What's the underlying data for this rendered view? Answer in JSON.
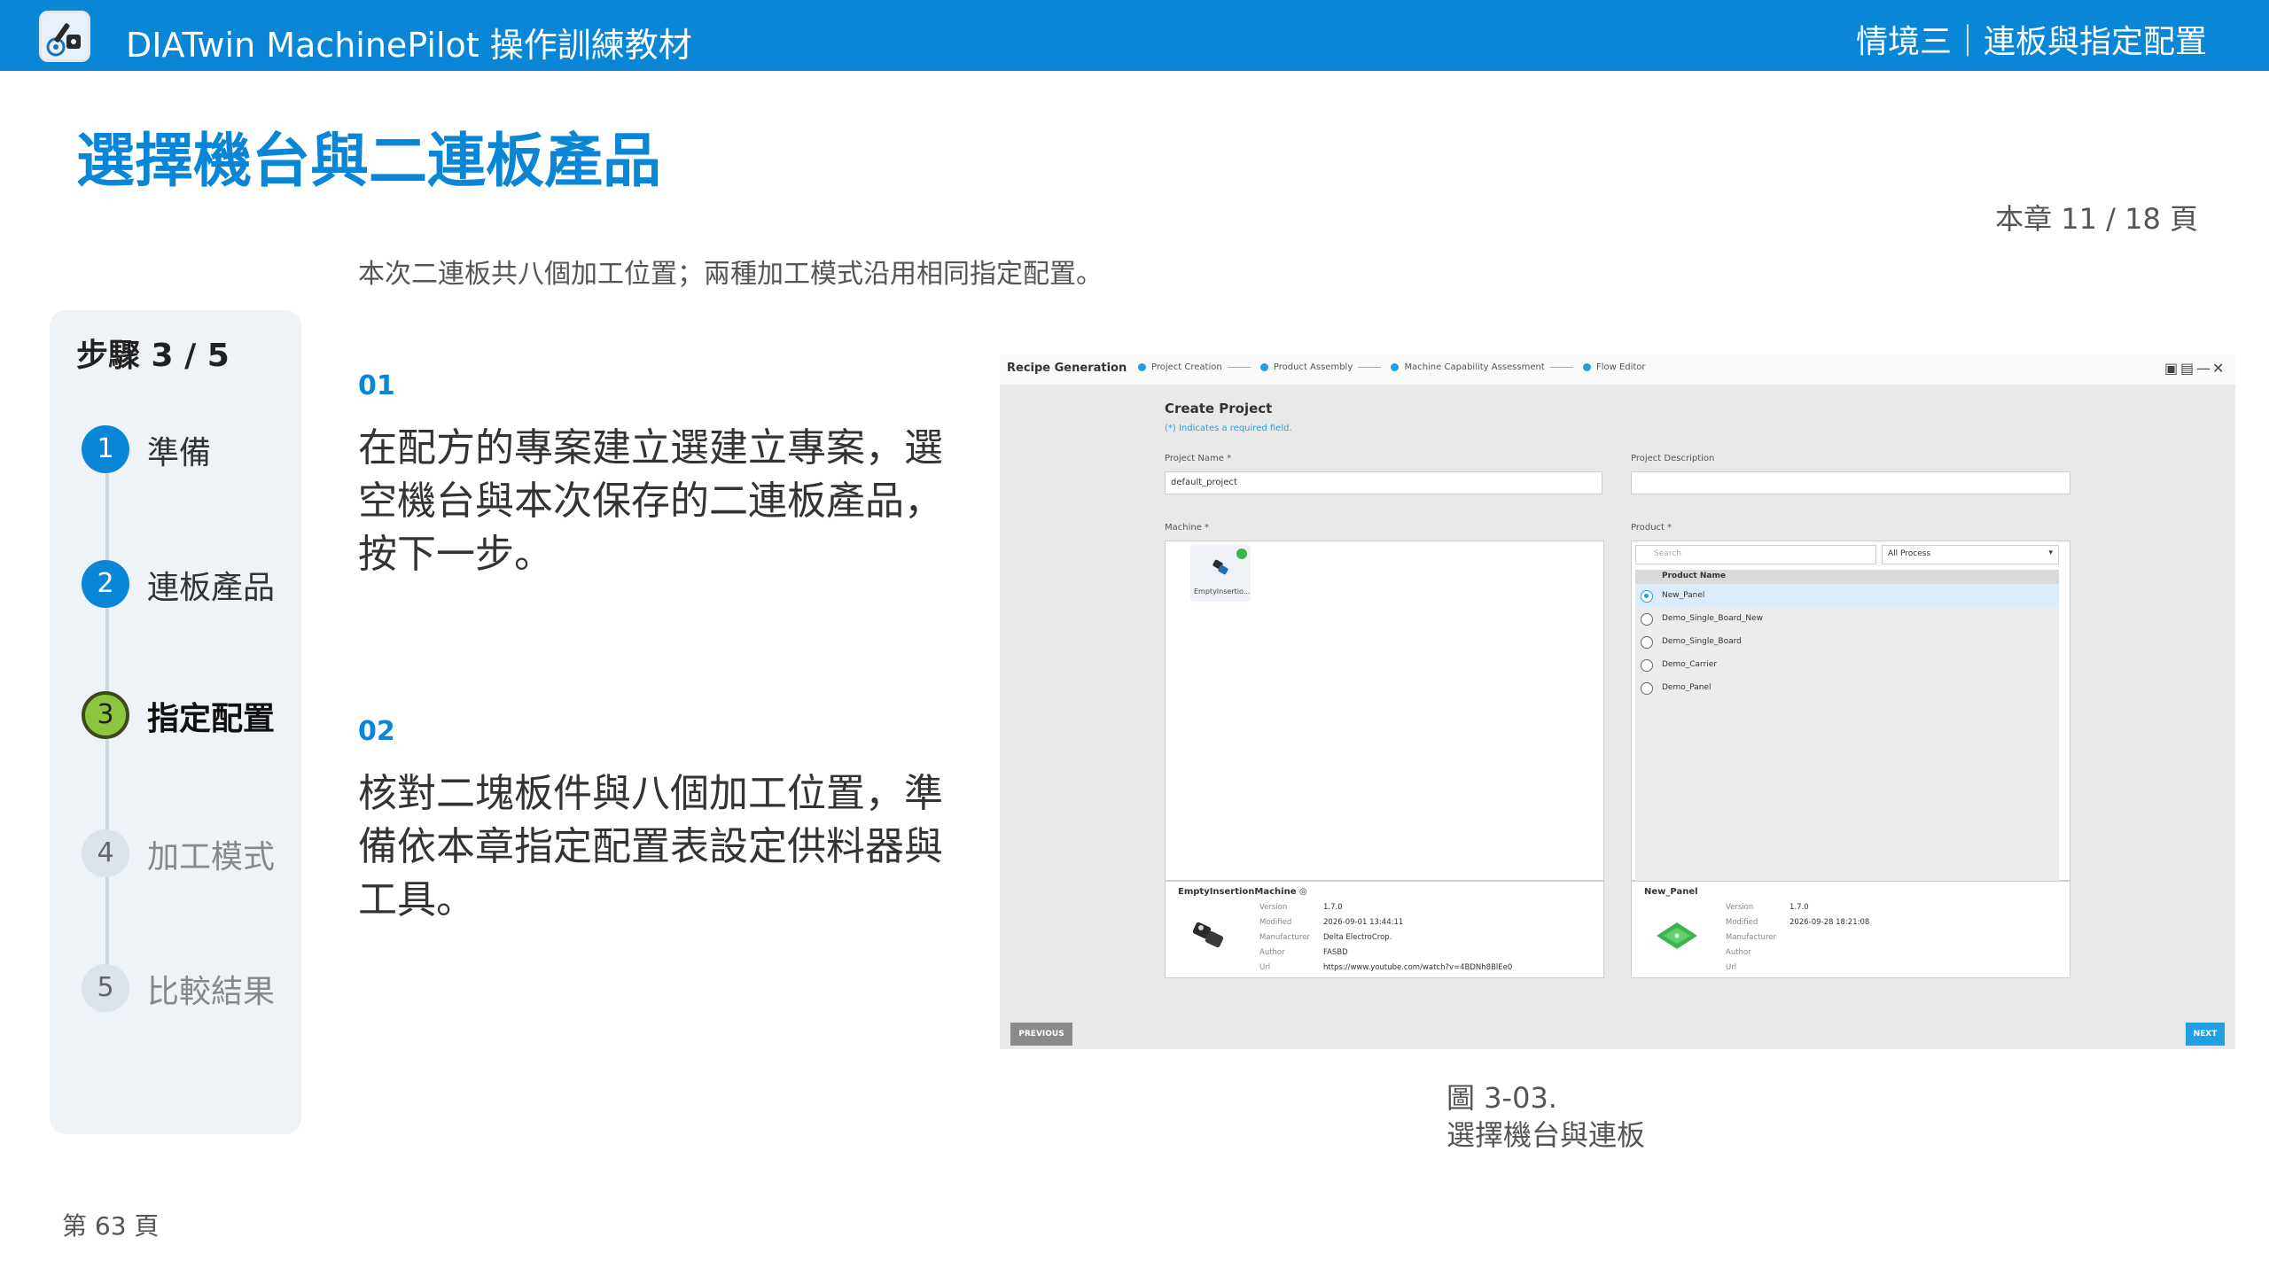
{
  "header": {
    "app_title": "DIATwin MachinePilot 操作訓練教材",
    "chapter_title": "情境三｜連板與指定配置"
  },
  "page": {
    "heading": "選擇機台與二連板產品",
    "chapter_page": "本章 11 / 18 頁",
    "intro": "本次二連板共八個加工位置；兩種加工模式沿用相同指定配置。",
    "page_number": "第 63 頁"
  },
  "steps": {
    "title": "步驟 3 / 5",
    "items": [
      {
        "num": "1",
        "label": "準備",
        "state": "done"
      },
      {
        "num": "2",
        "label": "連板產品",
        "state": "done"
      },
      {
        "num": "3",
        "label": "指定配置",
        "state": "current"
      },
      {
        "num": "4",
        "label": "加工模式",
        "state": "todo"
      },
      {
        "num": "5",
        "label": "比較結果",
        "state": "todo"
      }
    ]
  },
  "instructions": [
    {
      "num": "01",
      "text": "在配方的專案建立選建立專案，選空機台與本次保存的二連板產品，按下一步。"
    },
    {
      "num": "02",
      "text": "核對二塊板件與八個加工位置，準備依本章指定配置表設定供料器與工具。"
    }
  ],
  "screenshot": {
    "app_name": "Recipe Generation",
    "breadcrumbs": [
      "Project Creation",
      "Product Assembly",
      "Machine Capability Assessment",
      "Flow Editor"
    ],
    "window_icons": [
      "save-icon",
      "save-as-icon",
      "minimize-icon",
      "close-icon"
    ],
    "window_glyphs": [
      "▣",
      "▤",
      "—",
      "✕"
    ],
    "form_title": "Create Project",
    "required_note": "(*) Indicates a required field.",
    "project_name_label": "Project Name *",
    "project_name_value": "default_project",
    "project_desc_label": "Project Description",
    "project_desc_value": "",
    "machine_label": "Machine *",
    "machine_card_name": "EmptyInsertio...",
    "product_label": "Product *",
    "search_placeholder": "Search",
    "process_filter": "All Process",
    "product_header": "Product Name",
    "products": [
      {
        "name": "New_Panel",
        "selected": true
      },
      {
        "name": "Demo_Single_Board_New",
        "selected": false
      },
      {
        "name": "Demo_Single_Board",
        "selected": false
      },
      {
        "name": "Demo_Carrier",
        "selected": false
      },
      {
        "name": "Demo_Panel",
        "selected": false
      }
    ],
    "machine_info": {
      "name": "EmptyInsertionMachine",
      "fields": [
        {
          "key": "Version",
          "value": "1.7.0"
        },
        {
          "key": "Modified",
          "value": "2026-09-01 13:44:11"
        },
        {
          "key": "Manufacturer",
          "value": "Delta ElectroCrop."
        },
        {
          "key": "Author",
          "value": "FASBD"
        },
        {
          "key": "Url",
          "value": "https://www.youtube.com/watch?v=4BDNh8BlEe0"
        }
      ]
    },
    "product_info": {
      "name": "New_Panel",
      "fields": [
        {
          "key": "Version",
          "value": "1.7.0"
        },
        {
          "key": "Modified",
          "value": "2026-09-28 18:21:08"
        },
        {
          "key": "Manufacturer",
          "value": ""
        },
        {
          "key": "Author",
          "value": ""
        },
        {
          "key": "Url",
          "value": ""
        }
      ]
    },
    "previous_label": "PREVIOUS",
    "next_label": "NEXT",
    "colors": {
      "accent": "#1ea0e3",
      "pcb": "#3fb34f"
    }
  },
  "caption": {
    "line1": "圖 3-03.",
    "line2": "選擇機台與連板"
  },
  "colors": {
    "brand": "#0a86d6",
    "step_current": "#8cc63f"
  }
}
